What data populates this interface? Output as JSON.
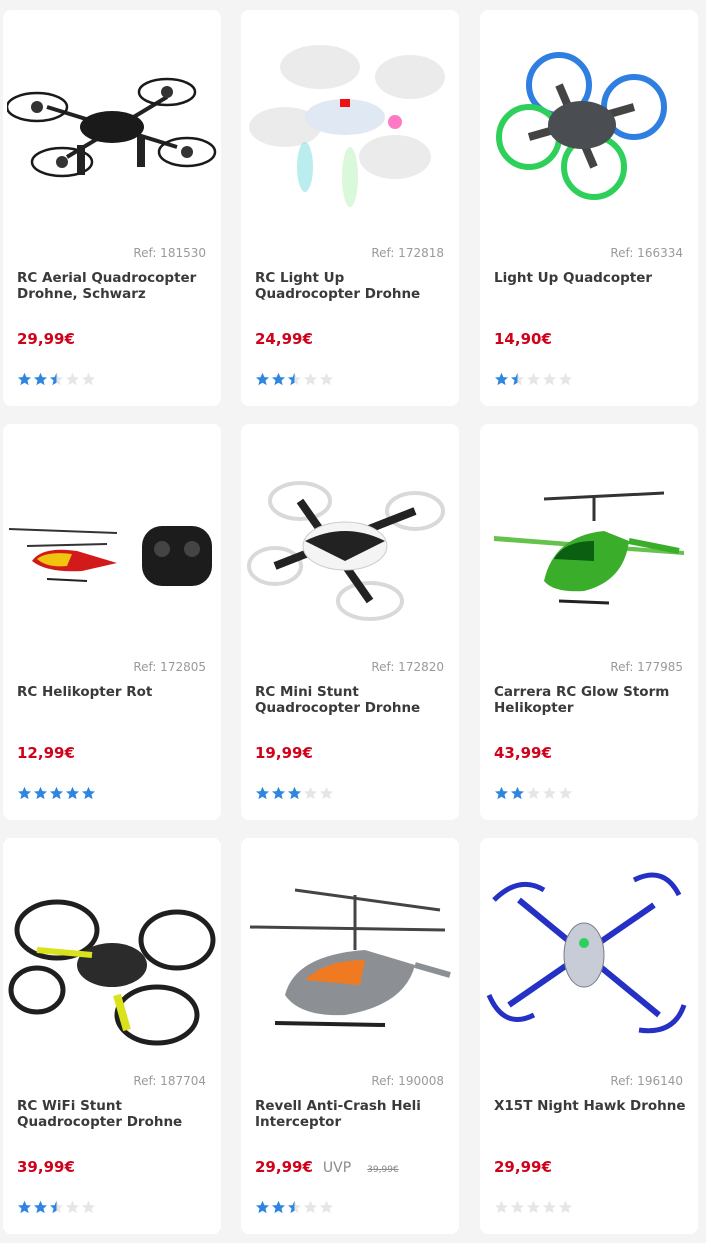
{
  "products": [
    {
      "ref": "Ref: 181530",
      "title": "RC Aerial Quadrocopter Drohne, Schwarz",
      "price": "29,99€",
      "rating": 2.5,
      "image": "black-quadcopter-drone"
    },
    {
      "ref": "Ref: 172818",
      "title": "RC Light Up Quadrocopter Drohne",
      "price": "24,99€",
      "rating": 2.5,
      "image": "white-light-up-quadcopter"
    },
    {
      "ref": "Ref: 166334",
      "title": "Light Up Quadcopter",
      "price": "14,90€",
      "rating": 1.5,
      "image": "green-blue-ring-quadcopter"
    },
    {
      "ref": "Ref: 172805",
      "title": "RC Helikopter Rot",
      "price": "12,99€",
      "rating": 5,
      "image": "red-helicopter-with-remote"
    },
    {
      "ref": "Ref: 172820",
      "title": "RC Mini Stunt Quadrocopter Drohne",
      "price": "19,99€",
      "rating": 3,
      "image": "white-black-mini-drone"
    },
    {
      "ref": "Ref: 177985",
      "title": "Carrera RC Glow Storm Helikopter",
      "price": "43,99€",
      "rating": 2,
      "image": "green-helicopter"
    },
    {
      "ref": "Ref: 187704",
      "title": "RC WiFi Stunt Quadrocopter Drohne",
      "price": "39,99€",
      "rating": 2.5,
      "image": "black-yellow-stunt-drone"
    },
    {
      "ref": "Ref: 190008",
      "title": "Revell Anti-Crash Heli Interceptor",
      "price": "29,99€",
      "uvp": "UVP",
      "old_price": "39,99€",
      "rating": 2.5,
      "image": "grey-orange-helicopter"
    },
    {
      "ref": "Ref: 196140",
      "title": "X15T Night Hawk Drohne",
      "price": "29,99€",
      "rating": 0,
      "image": "blue-night-hawk-drone"
    }
  ],
  "colors": {
    "price": "#d0021b",
    "star_full": "#2f86de",
    "star_empty": "#e6e6e6"
  }
}
